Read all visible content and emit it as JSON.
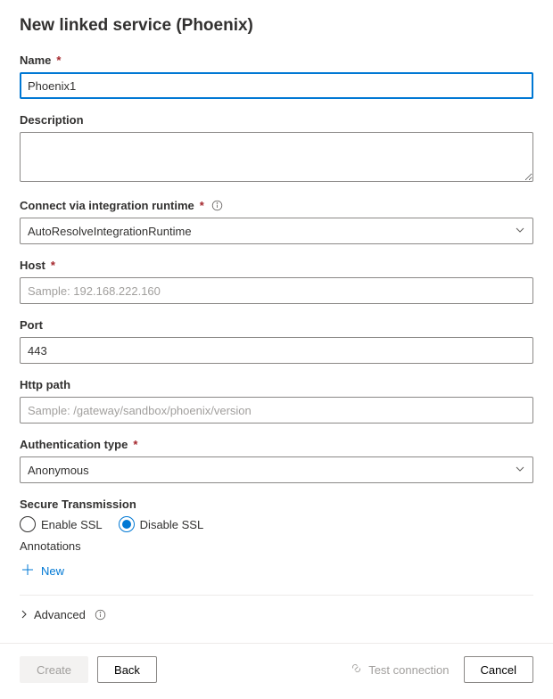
{
  "title": "New linked service (Phoenix)",
  "fields": {
    "name": {
      "label": "Name",
      "value": "Phoenix1"
    },
    "description": {
      "label": "Description",
      "value": ""
    },
    "runtime": {
      "label": "Connect via integration runtime",
      "value": "AutoResolveIntegrationRuntime"
    },
    "host": {
      "label": "Host",
      "value": "",
      "placeholder": "Sample: 192.168.222.160"
    },
    "port": {
      "label": "Port",
      "value": "443"
    },
    "httpPath": {
      "label": "Http path",
      "value": "",
      "placeholder": "Sample: /gateway/sandbox/phoenix/version"
    },
    "authType": {
      "label": "Authentication type",
      "value": "Anonymous"
    }
  },
  "secureTransmission": {
    "label": "Secure Transmission",
    "options": {
      "enable": "Enable SSL",
      "disable": "Disable SSL"
    },
    "selected": "disable"
  },
  "annotations": {
    "label": "Annotations",
    "newLabel": "New"
  },
  "advanced": {
    "label": "Advanced"
  },
  "footer": {
    "create": "Create",
    "back": "Back",
    "testConnection": "Test connection",
    "cancel": "Cancel"
  }
}
